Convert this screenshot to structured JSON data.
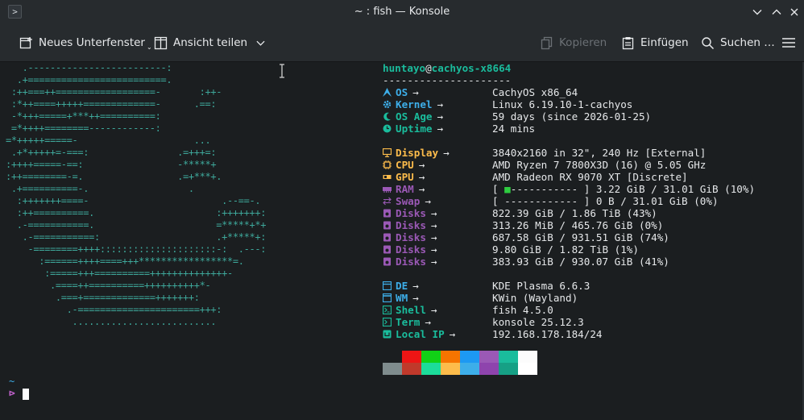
{
  "window": {
    "title": "~ : fish — Konsole",
    "app_icon": "terminal-icon"
  },
  "toolbar": {
    "new_tab_label": "Neues Unterfenster",
    "split_view_label": "Ansicht teilen",
    "copy_label": "Kopieren",
    "paste_label": "Einfügen",
    "find_label": "Suchen …"
  },
  "terminal": {
    "ascii_art": "   .-------------------------:\n  .+=========================.\n :++===++==================-       :++-\n :*++====+++++=============-      .==:\n -*+++=====+***++==========:\n =*++++========------------:\n=*+++++=====-                     ...\n .+*+++++=-===:                .=+++=:\n:++++=====-==:                 -*****+\n:++========-=.                 .=+***+.\n .+==========-.                  .\n  :+++++++====-                        .--==-.\n  :++==========.                      :+++++++:\n  .-===========.                      =*****+*+\n   .-===========:                     .+*****+:\n    -========++++:::::::::::::::::::::-:  .---:\n      :======++++====+++*****************=.\n       :=====+++==========++++++++++++++-\n        .====++==========++++++++++*-\n         .===+=============+++++++:\n           .-======================+++:\n            ..........................",
    "user": "huntayo",
    "at": "@",
    "host": "cachyos-x8664",
    "separator": "---------------------",
    "arrow": "→",
    "info": [
      {
        "key": "OS",
        "value": "CachyOS x86_64",
        "color": "#3daee9",
        "icon": "arch-logo-icon"
      },
      {
        "key": "Kernel",
        "value": "Linux 6.19.10-1-cachyos",
        "color": "#3daee9",
        "icon": "gear-icon"
      },
      {
        "key": "OS Age",
        "value": "59 days (since 2026-01-25)",
        "color": "#1abc9c",
        "icon": "moon-icon"
      },
      {
        "key": "Uptime",
        "value": "24 mins",
        "color": "#1abc9c",
        "icon": "clock-icon"
      },
      {
        "key": "Display",
        "value": "3840x2160 in 32\", 240 Hz [External]",
        "color": "#fdbc4b",
        "icon": "monitor-icon"
      },
      {
        "key": "CPU",
        "value": "AMD Ryzen 7 7800X3D (16) @ 5.05 GHz",
        "color": "#fdbc4b",
        "icon": "cpu-icon"
      },
      {
        "key": "GPU",
        "value": "AMD Radeon RX 9070 XT [Discrete]",
        "color": "#fdbc4b",
        "icon": "gpu-icon"
      },
      {
        "key": "RAM",
        "value_prefix": "[ ",
        "value_bar": "■",
        "value_rest": "----------- ] 3.22 GiB / 31.01 GiB (10%)",
        "color": "#9b59b6",
        "icon": "memory-icon"
      },
      {
        "key": "Swap",
        "value": "[ ------------ ] 0 B / 31.01 GiB (0%)",
        "color": "#9b59b6",
        "icon": "swap-icon"
      },
      {
        "key": "Disks",
        "value": "822.39 GiB / 1.86 TiB (43%)",
        "color": "#9b59b6",
        "icon": "disk-icon"
      },
      {
        "key": "Disks",
        "value": "313.26 MiB / 465.76 GiB (0%)",
        "color": "#9b59b6",
        "icon": "disk-icon"
      },
      {
        "key": "Disks",
        "value": "687.58 GiB / 931.51 GiB (74%)",
        "color": "#9b59b6",
        "icon": "disk-icon"
      },
      {
        "key": "Disks",
        "value": "9.80 GiB / 1.82 TiB (1%)",
        "color": "#9b59b6",
        "icon": "disk-icon"
      },
      {
        "key": "Disks",
        "value": "383.93 GiB / 930.07 GiB (41%)",
        "color": "#9b59b6",
        "icon": "disk-icon"
      },
      {
        "key": "DE",
        "value": "KDE Plasma 6.6.3",
        "color": "#3daee9",
        "icon": "desktop-icon"
      },
      {
        "key": "WM",
        "value": "KWin (Wayland)",
        "color": "#3daee9",
        "icon": "window-icon"
      },
      {
        "key": "Shell",
        "value": "fish 4.5.0",
        "color": "#1abc9c",
        "icon": "shell-icon"
      },
      {
        "key": "Term",
        "value": "konsole 25.12.3",
        "color": "#1abc9c",
        "icon": "terminal-icon"
      },
      {
        "key": "Local IP",
        "value": "192.168.178.184/24",
        "color": "#1abc9c",
        "icon": "network-icon"
      }
    ],
    "palette_top": [
      "#1b1e20",
      "#ed1515",
      "#11d116",
      "#f67400",
      "#1d99f3",
      "#9b59b6",
      "#1abc9c",
      "#fcfcfc"
    ],
    "palette_bottom": [
      "#7f8c8d",
      "#c0392b",
      "#1cdc9a",
      "#fdbc4b",
      "#3daee9",
      "#8e44ad",
      "#16a085",
      "#ffffff"
    ],
    "prompt_path": "~",
    "prompt_symbol": "⊳"
  }
}
